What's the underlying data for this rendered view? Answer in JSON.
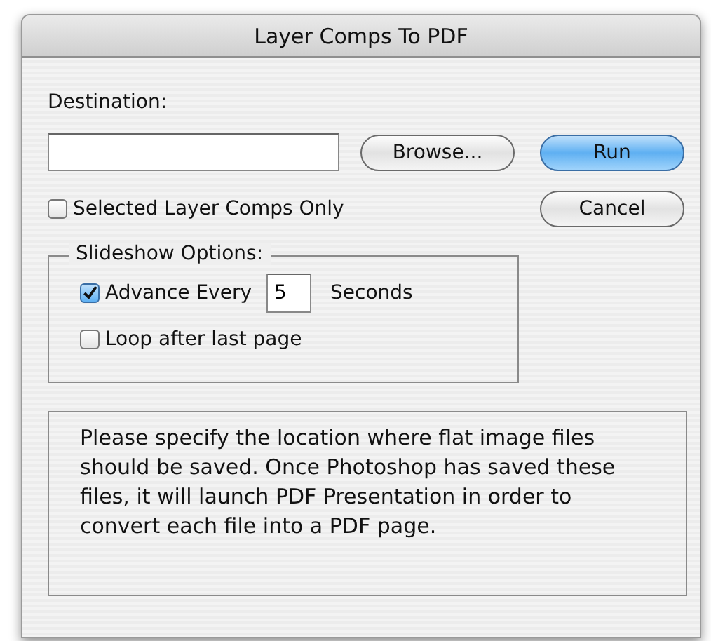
{
  "window": {
    "title": "Layer Comps To PDF"
  },
  "destination": {
    "label": "Destination:"
  },
  "browse_button": "Browse...",
  "run_button": {
    "label": "Run",
    "default": true
  },
  "cancel_button": "Cancel",
  "selected_only": {
    "label": "Selected Layer Comps Only",
    "checked": false
  },
  "slideshow": {
    "legend": "Slideshow Options:",
    "advance": {
      "label": "Advance Every",
      "checked": true,
      "value": "5",
      "unit": "Seconds"
    },
    "loop": {
      "label": "Loop after last page",
      "checked": false
    }
  },
  "description": "Please specify the location where flat image files should be saved. Once Photoshop has saved these files, it will launch PDF Presentation in order to convert each file into a PDF page."
}
